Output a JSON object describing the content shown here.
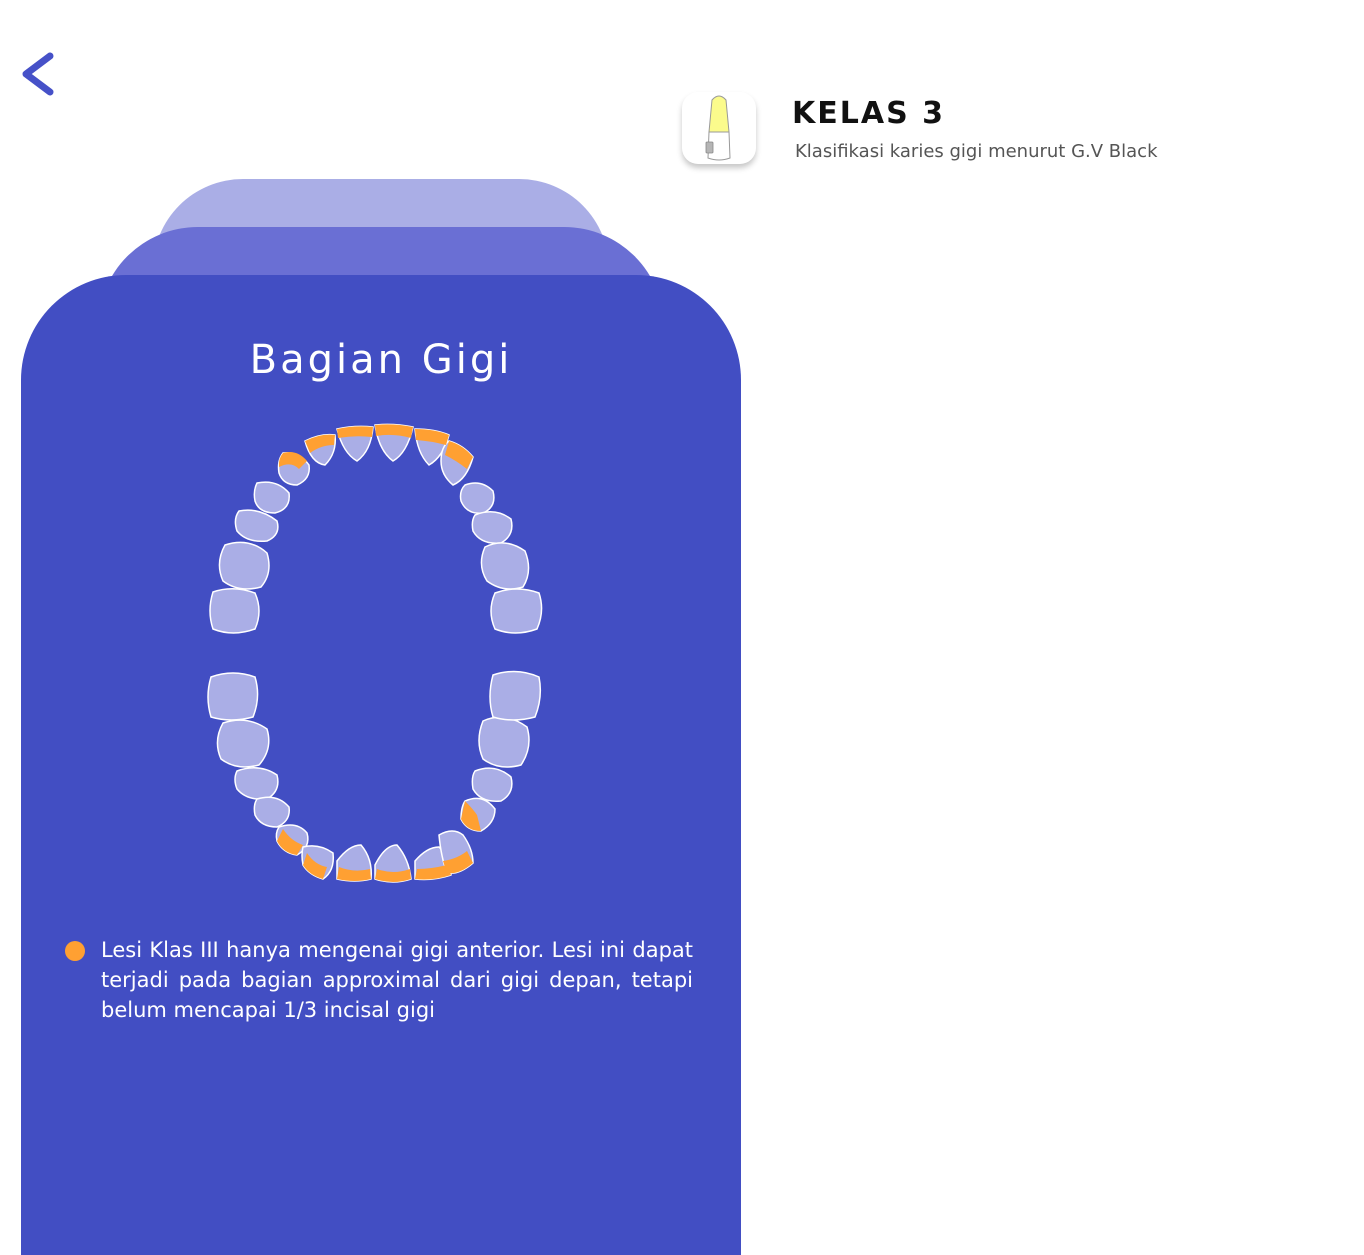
{
  "header": {
    "title": "KELAS 3",
    "subtitle": "Klasifikasi karies gigi menurut G.V Black",
    "icon": "tooth-icon"
  },
  "nav": {
    "back_icon": "chevron-left-icon"
  },
  "card": {
    "title": "Bagian Gigi",
    "description": "Lesi Klas III hanya mengenai gigi anterior. Lesi ini dapat terjadi pada bagian approximal dari gigi depan, tetapi belum mencapai 1/3 incisal gigi",
    "diagram_icon": "dental-arch-icon"
  },
  "colors": {
    "accent": "#424ec3",
    "tooth": "#aaaee6",
    "highlight": "#ffa032",
    "tab_mid": "#6a6fd4",
    "tab_light": "#aaaee6",
    "back_arrow": "#4651c8"
  }
}
